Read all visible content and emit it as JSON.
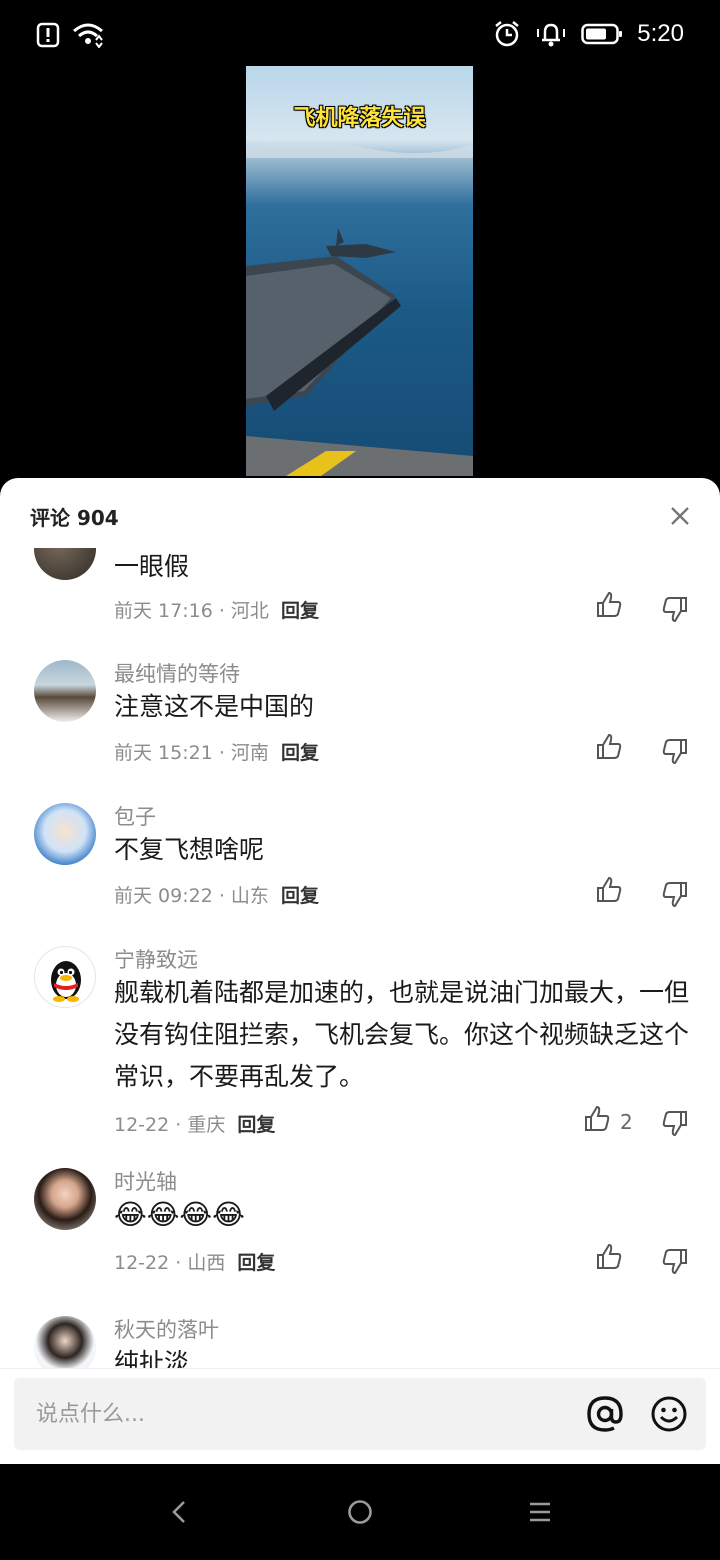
{
  "status": {
    "time": "5:20"
  },
  "video": {
    "title": "飞机降落失误"
  },
  "comments_header": {
    "label": "评论 904"
  },
  "comments": [
    {
      "name": "",
      "text": "一眼假",
      "time": "前天 17:16",
      "location": "河北",
      "reply": "回复",
      "likes": ""
    },
    {
      "name": "最纯情的等待",
      "text": "注意这不是中国的",
      "time": "前天 15:21",
      "location": "河南",
      "reply": "回复",
      "likes": ""
    },
    {
      "name": "包子",
      "text": "不复飞想啥呢",
      "time": "前天 09:22",
      "location": "山东",
      "reply": "回复",
      "likes": ""
    },
    {
      "name": "宁静致远",
      "text": "舰载机着陆都是加速的，也就是说油门加最大，一但没有钩住阻拦索，飞机会复飞。你这个视频缺乏这个常识，不要再乱发了。",
      "time": "12-22",
      "location": "重庆",
      "reply": "回复",
      "likes": "2"
    },
    {
      "name": "时光轴",
      "text": "😂😂😂😂",
      "time": "12-22",
      "location": "山西",
      "reply": "回复",
      "likes": ""
    },
    {
      "name": "秋天的落叶",
      "text": "纯扯淡",
      "time": "",
      "location": "",
      "reply": "",
      "likes": ""
    }
  ],
  "input": {
    "placeholder": "说点什么..."
  },
  "colors": {
    "video_title": "#ffe338",
    "sheet_bg": "#ffffff",
    "muted_text": "#8c8c8c"
  }
}
